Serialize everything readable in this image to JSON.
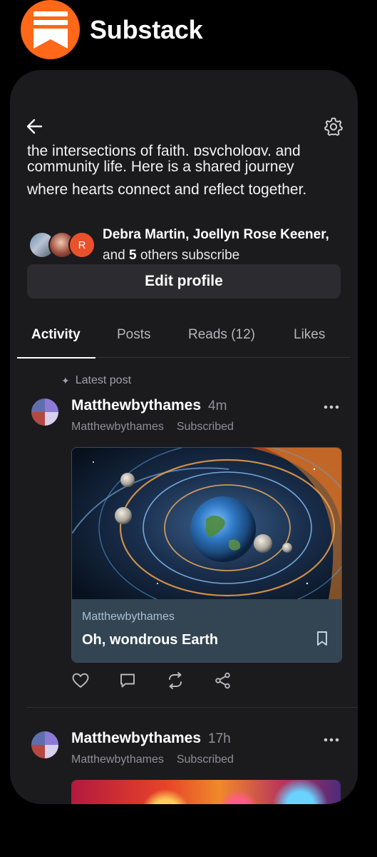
{
  "brand": {
    "name": "Substack",
    "logo_icon": "substack-logo-icon",
    "accent": "#ff6719"
  },
  "header": {
    "back_icon": "back-arrow-icon",
    "settings_icon": "gear-icon"
  },
  "profile": {
    "bio_cut_line": "the intersections of faith, psychology, and",
    "bio_line2": "community life. Here is a shared journey",
    "bio_line3": "where hearts connect and reflect together.",
    "subscribers": {
      "avatar_initial": "R",
      "names": "Debra Martin, Joellyn Rose Keener,",
      "prefix": "and",
      "count": "5",
      "suffix": "others subscribe"
    },
    "edit_profile_label": "Edit profile"
  },
  "tabs": [
    {
      "label": "Activity",
      "active": true
    },
    {
      "label": "Posts",
      "active": false
    },
    {
      "label": "Reads (12)",
      "active": false
    },
    {
      "label": "Likes",
      "active": false
    }
  ],
  "feed": {
    "latest_label": "Latest post",
    "posts": [
      {
        "author": "Matthewbythames",
        "time": "4m",
        "publication": "Matthewbythames",
        "status": "Subscribed",
        "embed": {
          "publication": "Matthewbythames",
          "title": "Oh, wondrous Earth"
        }
      },
      {
        "author": "Matthewbythames",
        "time": "17h",
        "publication": "Matthewbythames",
        "status": "Subscribed"
      }
    ]
  },
  "post_actions": [
    "heart-icon",
    "comment-icon",
    "restack-icon",
    "share-icon"
  ]
}
